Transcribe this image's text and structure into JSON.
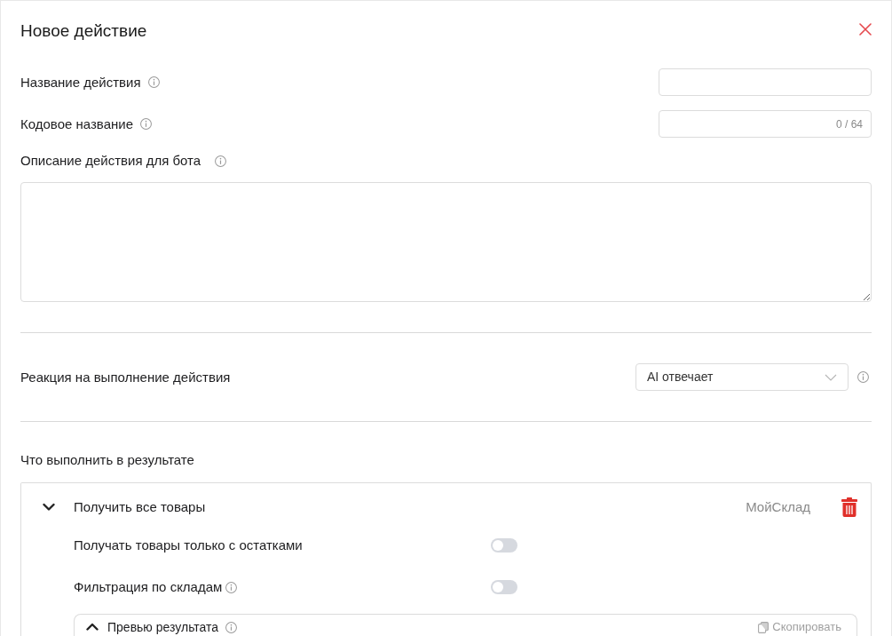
{
  "dialog": {
    "title": "Новое действие"
  },
  "fields": [
    {
      "kind": "input",
      "label": "Название действия"
    },
    {
      "kind": "counter",
      "label": "Кодовое название",
      "counter": "0 / 64"
    },
    {
      "kind": "textarea",
      "label": "Описание действия для бота"
    }
  ],
  "reaction": {
    "label": "Реакция на выполнение действия",
    "value": "AI отвечает"
  },
  "result": {
    "heading": "Что выполнить в результате",
    "actions": [
      {
        "title": "Получить все товары",
        "source": "МойСклад",
        "expanded": true,
        "options": [
          {
            "label": "Получать товары только с остатками",
            "info": false,
            "on": false
          },
          {
            "label": "Фильтрация по складам",
            "info": true,
            "on": false
          }
        ],
        "preview": {
          "title": "Превью результата",
          "copy_label": "Скопировать"
        }
      }
    ]
  }
}
